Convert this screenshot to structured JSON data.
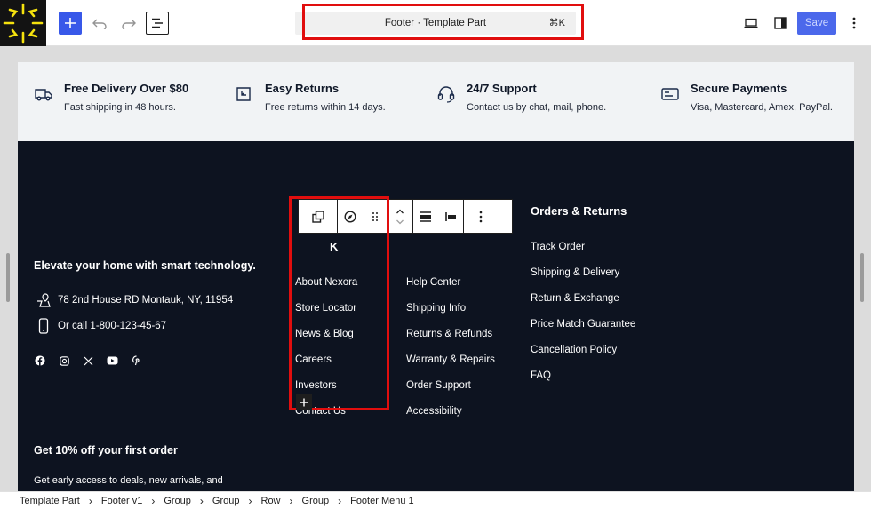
{
  "toolbar": {
    "logo_icon": "sunburst-logo-icon",
    "add_icon": "plus-icon",
    "undo_icon": "undo-icon",
    "redo_icon": "redo-icon",
    "list_view_icon": "list-view-icon",
    "document_title": "Footer · Template Part",
    "shortcut": "⌘K",
    "device_icon": "desktop-preview-icon",
    "sidebar_icon": "sidebar-toggle-icon",
    "save_label": "Save",
    "more_icon": "vertical-ellipsis-icon",
    "accent_color": "#3858e9",
    "highlight_color": "#e10e0e"
  },
  "features": [
    {
      "title": "Free Delivery Over $80",
      "desc": "Fast shipping in 48 hours.",
      "icon": "truck-icon"
    },
    {
      "title": "Easy Returns",
      "desc": "Free returns within 14 days.",
      "icon": "return-box-icon"
    },
    {
      "title": "24/7 Support",
      "desc": "Contact us by chat, mail, phone.",
      "icon": "headset-icon"
    },
    {
      "title": "Secure Payments",
      "desc": "Visa, Mastercard, Amex, PayPal.",
      "icon": "credit-card-icon"
    }
  ],
  "footer": {
    "tagline": "Elevate your home with smart technology.",
    "address": "78 2nd House RD Montauk, NY, 11954",
    "phone": "Or call 1-800-123-45-67",
    "address_icon": "map-pin-icon",
    "phone_icon": "phone-icon",
    "socials": [
      "facebook-icon",
      "instagram-icon",
      "x-icon",
      "youtube-icon",
      "pinterest-icon"
    ],
    "background_color": "#0d1320",
    "menus": [
      {
        "heading": "K",
        "links": [
          "About Nexora",
          "Store Locator",
          "News & Blog",
          "Careers",
          "Investors",
          "Contact Us"
        ]
      },
      {
        "heading": "",
        "links": [
          "Help Center",
          "Shipping Info",
          "Returns & Refunds",
          "Warranty & Repairs",
          "Order Support",
          "Accessibility"
        ]
      },
      {
        "heading": "Orders & Returns",
        "links": [
          "Track Order",
          "Shipping & Delivery",
          "Return & Exchange",
          "Price Match Guarantee",
          "Cancellation Policy",
          "FAQ"
        ]
      }
    ],
    "newsletter_title": "Get 10% off your first order",
    "newsletter_desc": "Get early access to deals, new arrivals, and"
  },
  "block_toolbar": {
    "buttons": [
      "navigation-parent-icon",
      "compass-icon",
      "drag-handle-icon",
      "move-up-down-icon",
      "justify-icon",
      "align-left-icon",
      "more-options-icon"
    ],
    "appender_icon": "plus-icon"
  },
  "breadcrumb": [
    "Template Part",
    "Footer v1",
    "Group",
    "Group",
    "Row",
    "Group",
    "Footer Menu 1"
  ]
}
